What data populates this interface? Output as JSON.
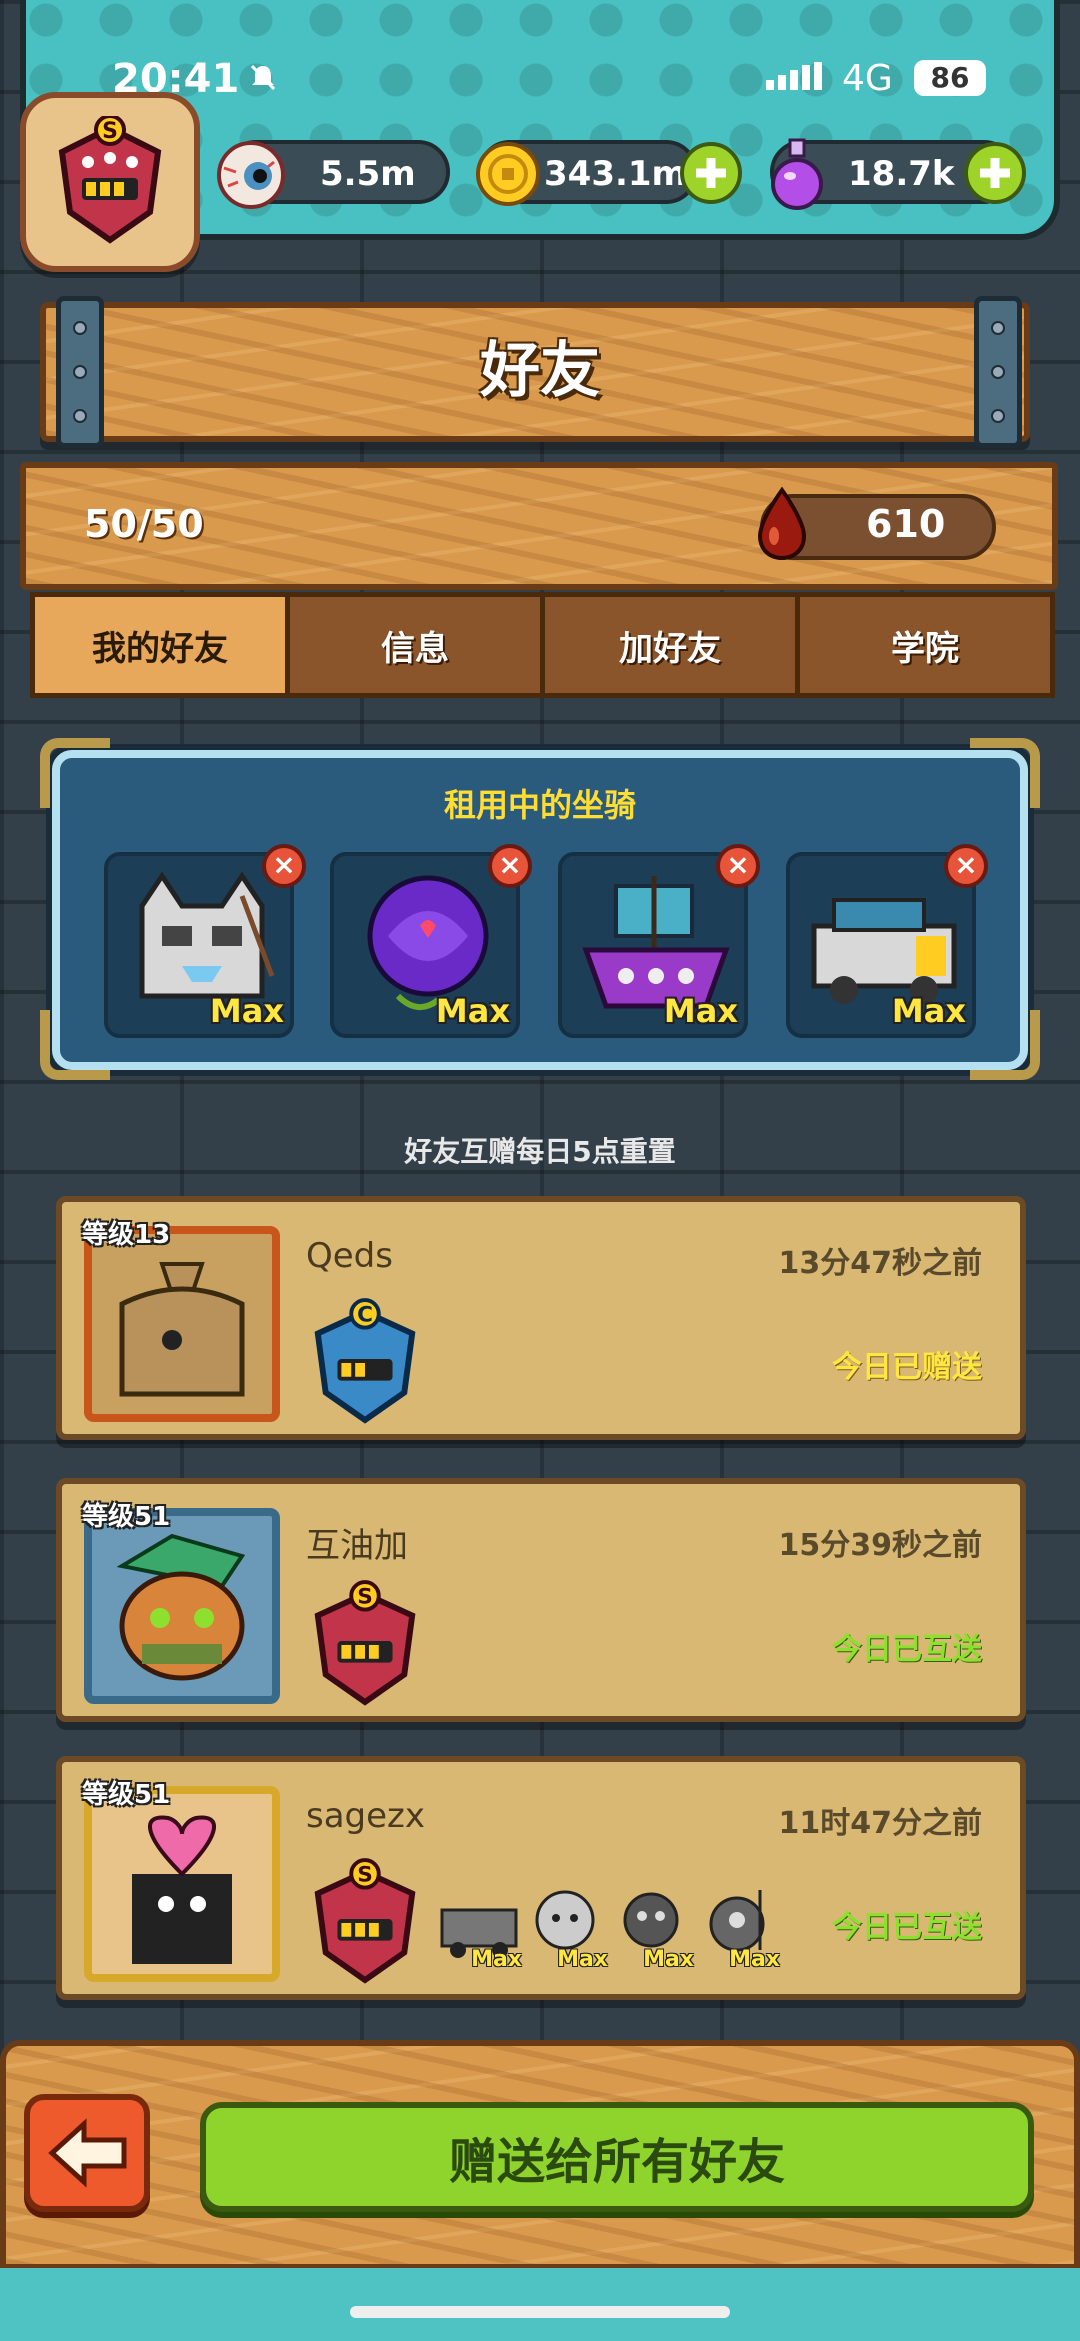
{
  "status_bar": {
    "time": "20:41",
    "network": "4G",
    "battery": "86"
  },
  "resources": [
    {
      "icon": "eyeball-icon",
      "value": "5.5m"
    },
    {
      "icon": "gold-coin-icon",
      "value": "343.1m"
    },
    {
      "icon": "potion-icon",
      "value": "18.7k"
    }
  ],
  "title": "好友",
  "friend_count": "50/50",
  "blood_points": "610",
  "tabs": [
    {
      "label": "我的好友",
      "active": true
    },
    {
      "label": "信息",
      "active": false
    },
    {
      "label": "加好友",
      "active": false
    },
    {
      "label": "学院",
      "active": false
    }
  ],
  "mounts": {
    "title": "租用中的坐骑",
    "items": [
      {
        "name": "cat-mount-icon",
        "level": "Max"
      },
      {
        "name": "rose-mount-icon",
        "level": "Max"
      },
      {
        "name": "ship-mount-icon",
        "level": "Max"
      },
      {
        "name": "truck-mount-icon",
        "level": "Max"
      }
    ]
  },
  "reset_note": "好友互赠每日5点重置",
  "friends": [
    {
      "level": "等级13",
      "name": "Qeds",
      "time": "13分47秒之前",
      "status": "今日已赠送",
      "rank": "C",
      "mounts": []
    },
    {
      "level": "等级51",
      "name": "互油加",
      "time": "15分39秒之前",
      "status": "今日已互送",
      "rank": "S",
      "mounts": []
    },
    {
      "level": "等级51",
      "name": "sagezx",
      "time": "11时47分之前",
      "status": "今日已互送",
      "rank": "S",
      "mounts": [
        {
          "level": "Max"
        },
        {
          "level": "Max"
        },
        {
          "level": "Max"
        },
        {
          "level": "Max"
        }
      ]
    }
  ],
  "gift_all_button": "赠送给所有好友",
  "colors": {
    "accent_green": "#8fd42c",
    "wood": "#d99a4e",
    "teal": "#49c1c2",
    "gold_text": "#ffe640"
  }
}
